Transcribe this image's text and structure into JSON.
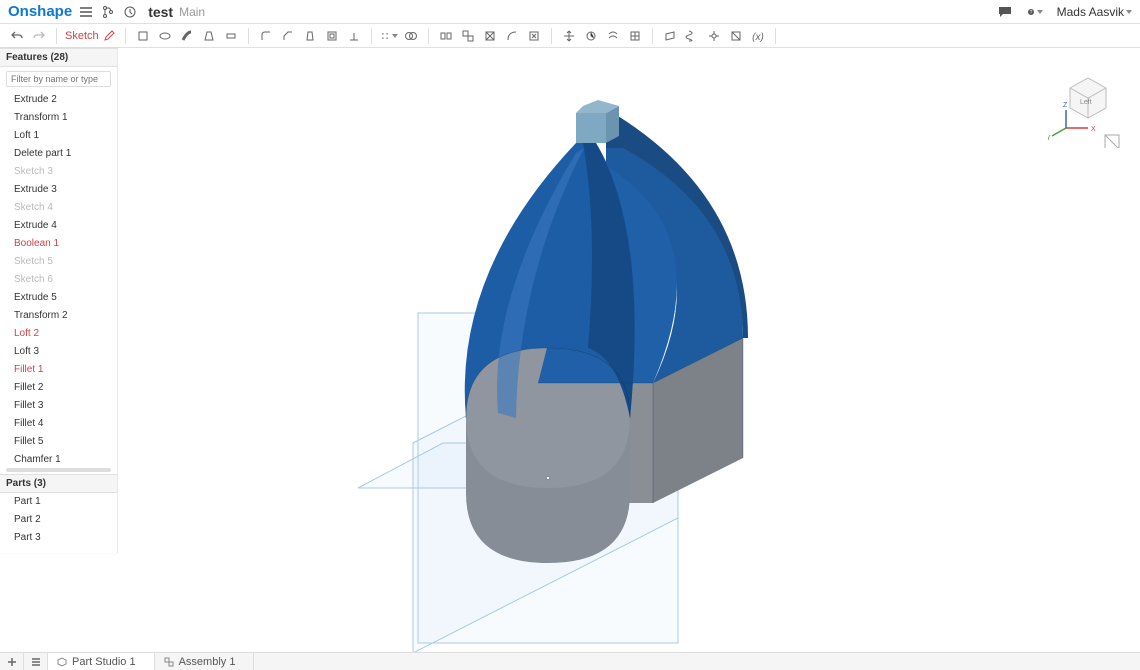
{
  "header": {
    "logo": "Onshape",
    "docName": "test",
    "workspace": "Main",
    "userName": "Mads Aasvik"
  },
  "toolbar": {
    "sketchLabel": "Sketch"
  },
  "featurePanel": {
    "title": "Features (28)",
    "filterPlaceholder": "Filter by name or type",
    "items": [
      {
        "label": "Extrude 2",
        "state": "normal"
      },
      {
        "label": "Transform 1",
        "state": "normal"
      },
      {
        "label": "Loft 1",
        "state": "normal"
      },
      {
        "label": "Delete part 1",
        "state": "normal"
      },
      {
        "label": "Sketch 3",
        "state": "suppressed"
      },
      {
        "label": "Extrude 3",
        "state": "normal"
      },
      {
        "label": "Sketch 4",
        "state": "suppressed"
      },
      {
        "label": "Extrude 4",
        "state": "normal"
      },
      {
        "label": "Boolean 1",
        "state": "error"
      },
      {
        "label": "Sketch 5",
        "state": "suppressed"
      },
      {
        "label": "Sketch 6",
        "state": "suppressed"
      },
      {
        "label": "Extrude 5",
        "state": "normal"
      },
      {
        "label": "Transform 2",
        "state": "normal"
      },
      {
        "label": "Loft 2",
        "state": "error"
      },
      {
        "label": "Loft 3",
        "state": "normal"
      },
      {
        "label": "Fillet 1",
        "state": "error"
      },
      {
        "label": "Fillet 2",
        "state": "normal"
      },
      {
        "label": "Fillet 3",
        "state": "normal"
      },
      {
        "label": "Fillet 4",
        "state": "normal"
      },
      {
        "label": "Fillet 5",
        "state": "normal"
      },
      {
        "label": "Chamfer 1",
        "state": "normal"
      }
    ]
  },
  "partsPanel": {
    "title": "Parts (3)",
    "items": [
      {
        "label": "Part 1"
      },
      {
        "label": "Part 2"
      },
      {
        "label": "Part 3"
      }
    ]
  },
  "dock": {
    "tabs": [
      {
        "label": "Part Studio 1",
        "active": true
      },
      {
        "label": "Assembly 1",
        "active": false
      }
    ]
  },
  "viewcube": {
    "face": "Left",
    "axes": {
      "x": "X",
      "y": "Y",
      "z": "Z"
    }
  }
}
